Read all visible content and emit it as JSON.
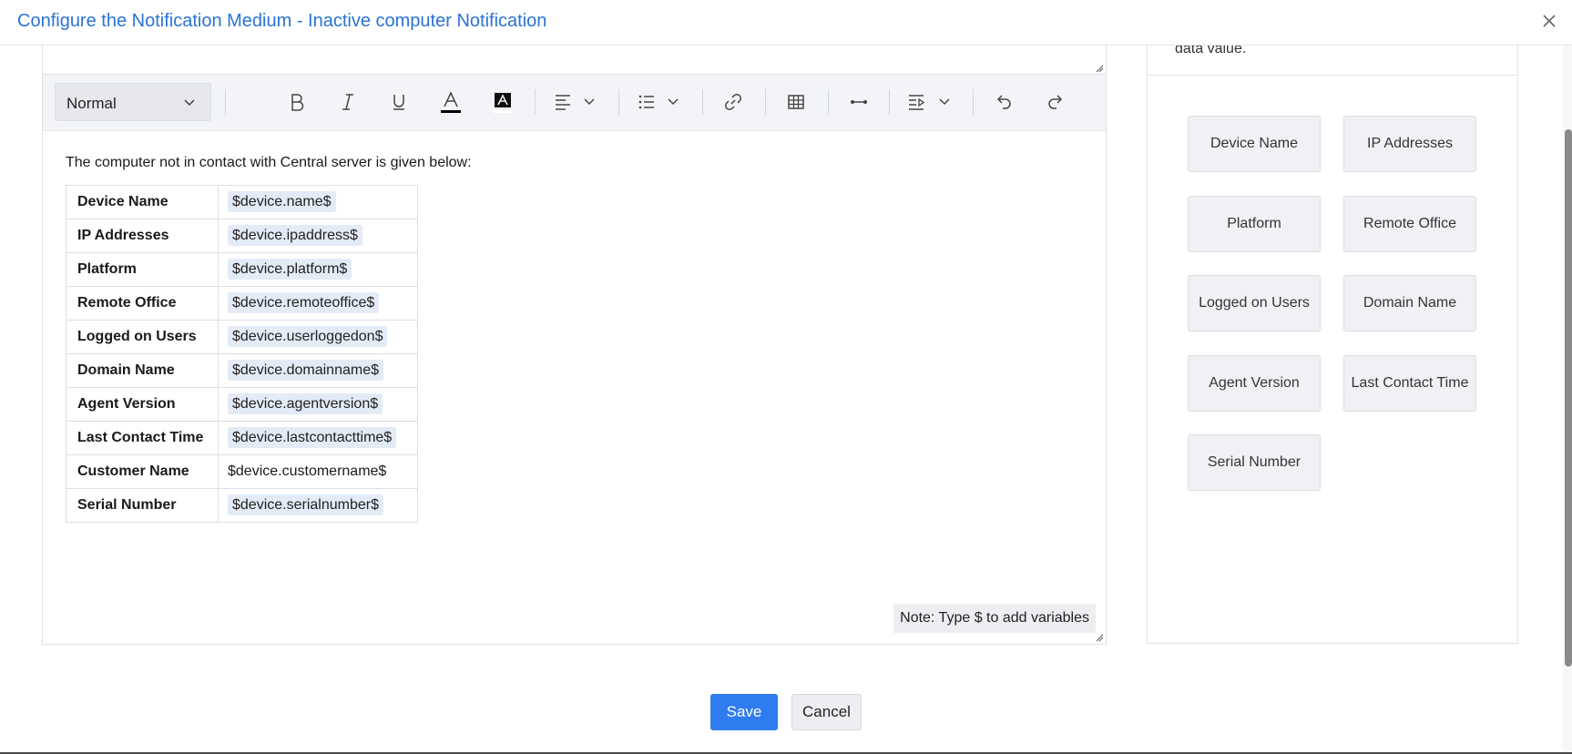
{
  "dialog": {
    "title": "Configure the Notification Medium - Inactive computer Notification"
  },
  "toolbar": {
    "format_value": "Normal",
    "buttons": [
      "bold-icon",
      "italic-icon",
      "underline-icon",
      "font-color-icon",
      "highlight-color-icon",
      "align-icon",
      "list-icon",
      "link-icon",
      "table-icon",
      "horizontal-line-icon",
      "insert-field-icon",
      "undo-icon",
      "redo-icon"
    ]
  },
  "editor": {
    "intro": "The computer not in contact with Central server is given below:",
    "rows": [
      {
        "label": "Device Name",
        "value": "$device.name$",
        "chip": true
      },
      {
        "label": "IP Addresses",
        "value": "$device.ipaddress$",
        "chip": true
      },
      {
        "label": "Platform",
        "value": "$device.platform$",
        "chip": true
      },
      {
        "label": "Remote Office",
        "value": "$device.remoteoffice$",
        "chip": true
      },
      {
        "label": "Logged on Users",
        "value": "$device.userloggedon$",
        "chip": true
      },
      {
        "label": "Domain Name",
        "value": "$device.domainname$",
        "chip": true
      },
      {
        "label": "Agent Version",
        "value": "$device.agentversion$",
        "chip": true
      },
      {
        "label": "Last Contact Time",
        "value": "$device.lastcontacttime$",
        "chip": true
      },
      {
        "label": "Customer Name",
        "value": "$device.customername$",
        "chip": false
      },
      {
        "label": "Serial Number",
        "value": "$device.serialnumber$",
        "chip": true
      }
    ],
    "note": "Note: Type $ to add variables"
  },
  "variables_panel": {
    "hint": "data value.",
    "buttons": [
      "Device Name",
      "IP Addresses",
      "Platform",
      "Remote Office",
      "Logged on Users",
      "Domain Name",
      "Agent Version",
      "Last Contact Time",
      "Serial Number"
    ]
  },
  "footer": {
    "save_label": "Save",
    "cancel_label": "Cancel"
  },
  "colors": {
    "title": "#2a73d6",
    "primary_button": "#2f7bf0",
    "chip_bg": "#e3ebf7"
  }
}
